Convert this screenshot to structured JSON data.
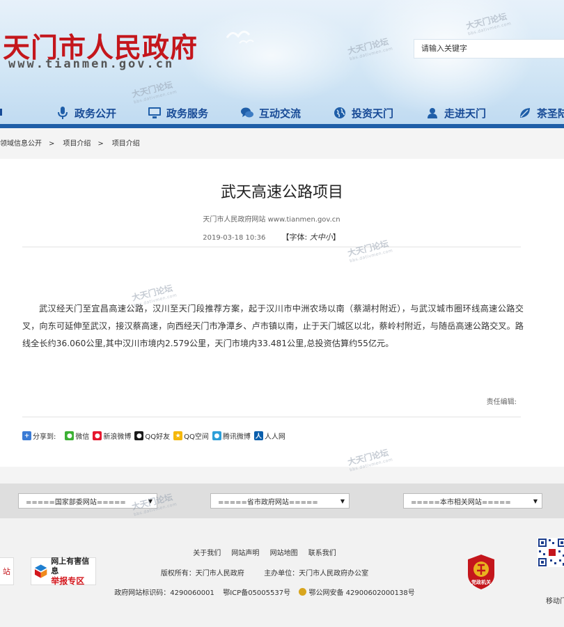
{
  "header": {
    "site_title": "天门市人民政府",
    "site_url": "www.tianmen.gov.cn",
    "search_placeholder": "请输入关键字",
    "nav": [
      {
        "label": "政务公开",
        "icon": "microphone-icon"
      },
      {
        "label": "政务服务",
        "icon": "monitor-icon"
      },
      {
        "label": "互动交流",
        "icon": "chat-bubbles-icon"
      },
      {
        "label": "投资天门",
        "icon": "globe-icon"
      },
      {
        "label": "走进天门",
        "icon": "person-icon"
      },
      {
        "label": "茶圣陆",
        "icon": "leaf-icon"
      }
    ]
  },
  "breadcrumb": [
    "领域信息公开",
    "项目介绍",
    "项目介绍"
  ],
  "breadcrumb_separator": ">",
  "article": {
    "title": "武天高速公路项目",
    "source": "天门市人民政府网站 www.tianmen.gov.cn",
    "date": "2019-03-18 10:36",
    "font_label_open": "【字体:",
    "font_large": "大",
    "font_medium": "中",
    "font_small": "小",
    "font_label_close": "】",
    "body": "武汉经天门至宜昌高速公路，汉川至天门段推荐方案，起于汉川市中洲农场以南（蔡湖村附近），与武汉城市圈环线高速公路交叉，向东可延伸至武汉，接汉蔡高速，向西经天门市净潭乡、卢市镇以南，止于天门城区以北，蔡岭村附近，与随岳高速公路交叉。路线全长约36.060公里,其中汉川市境内2.579公里，天门市境内33.481公里,总投资估算约55亿元。",
    "editor_label": "责任编辑:",
    "share_label": "分享到:",
    "share_items": [
      {
        "label": "微信",
        "icon": "wechat-icon",
        "color": "#3cb034"
      },
      {
        "label": "新浪微博",
        "icon": "weibo-icon",
        "color": "#e6162d"
      },
      {
        "label": "QQ好友",
        "icon": "qq-icon",
        "color": "#1a1a1a"
      },
      {
        "label": "QQ空间",
        "icon": "qzone-icon",
        "color": "#f5b80b"
      },
      {
        "label": "腾讯微博",
        "icon": "tencent-weibo-icon",
        "color": "#2d9fd8"
      },
      {
        "label": "人人网",
        "icon": "renren-icon",
        "color": "#0b5fad"
      }
    ]
  },
  "link_selects": [
    "=====国家部委网站=====",
    "=====省市政府网站=====",
    "=====本市相关网站====="
  ],
  "footer": {
    "links": [
      "关于我们",
      "网站声明",
      "网站地图",
      "联系我们"
    ],
    "copyright": "版权所有：天门市人民政府",
    "sponsor": "主办单位：天门市人民政府办公室",
    "site_id": "政府网站标识码：4290060001",
    "icp": "鄂ICP备05005537号",
    "police": "鄂公网安备 42900602000138号",
    "report_line1": "网上有害信息",
    "report_line2": "举报专区",
    "left_cut_text": "站",
    "badge_text": "党政机关",
    "qr_label": "移动门"
  },
  "watermark": {
    "text": "大天门论坛",
    "sub": "bbs.dativmen.com"
  },
  "colors": {
    "brand_red": "#c4161c",
    "nav_blue": "#174a96",
    "nav_bar": "#1f5ea8"
  }
}
